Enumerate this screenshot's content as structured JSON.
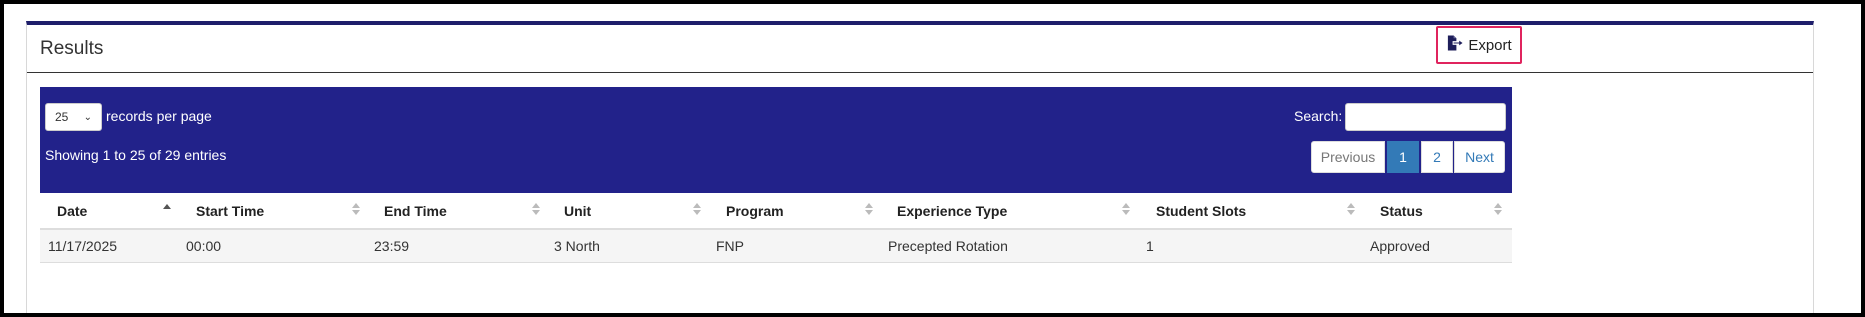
{
  "panel": {
    "title": "Results",
    "export_label": "Export"
  },
  "controls": {
    "page_length": "25",
    "page_length_suffix": "records per page",
    "info": "Showing 1 to 25 of 29 entries",
    "search_label": "Search:",
    "search_value": "",
    "pagination": {
      "previous": "Previous",
      "pages": [
        "1",
        "2"
      ],
      "current_page": "1",
      "next": "Next"
    }
  },
  "table": {
    "columns": [
      "Date",
      "Start Time",
      "End Time",
      "Unit",
      "Program",
      "Experience Type",
      "Student Slots",
      "Status"
    ],
    "sorted_column": "Date",
    "sort_direction": "ascending",
    "rows": [
      [
        "11/17/2025",
        "00:00",
        "23:59",
        "3 North",
        "FNP",
        "Precepted Rotation",
        "1",
        "Approved"
      ]
    ]
  },
  "colors": {
    "header_bar": "#22228a",
    "panel_top_border": "#1e1e6b",
    "export_highlight": "#e0245e",
    "active_page": "#337ab7"
  },
  "icons": {
    "export": "file-export-icon"
  }
}
